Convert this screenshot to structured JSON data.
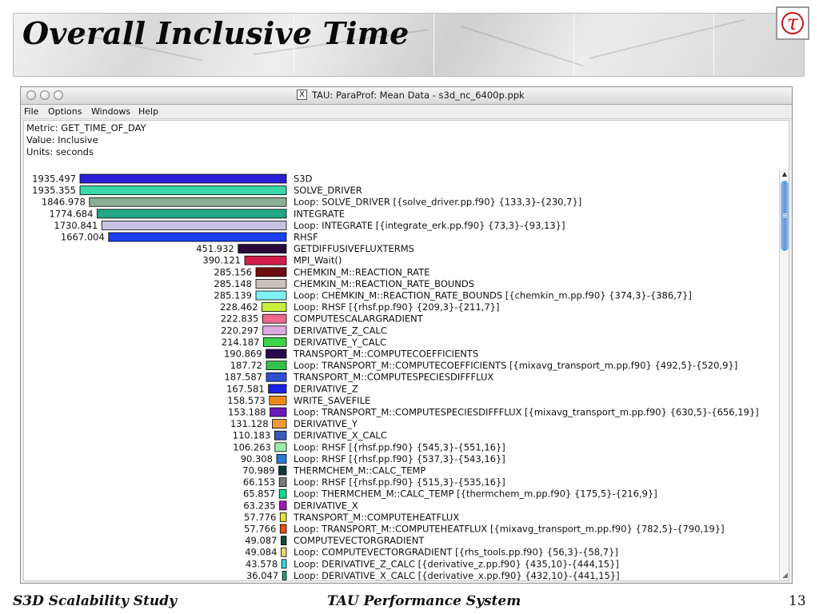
{
  "slide": {
    "title": "Overall Inclusive Time",
    "logo_glyph": "τ",
    "footer_left": "S3D Scalability Study",
    "footer_center": "TAU Performance System",
    "page_number": "13"
  },
  "window": {
    "title": "TAU: ParaProf: Mean Data - s3d_nc_6400p.ppk",
    "title_icon": "X"
  },
  "menu": [
    "File",
    "Options",
    "Windows",
    "Help"
  ],
  "info": {
    "metric": "Metric: GET_TIME_OF_DAY",
    "value": "Value: Inclusive",
    "units": "Units: seconds"
  },
  "colors": {
    "scroll_thumb": "#5f95d7",
    "title_accent": "#c41818"
  },
  "chart_data": {
    "type": "bar",
    "orientation": "horizontal",
    "max_value": 1935.497,
    "rows": [
      {
        "value": 1935.497,
        "label": "1935.497",
        "name": "S3D",
        "color": "#2b1fd6"
      },
      {
        "value": 1935.355,
        "label": "1935.355",
        "name": "SOLVE_DRIVER",
        "color": "#3ad7a8"
      },
      {
        "value": 1846.978,
        "label": "1846.978",
        "name": "Loop: SOLVE_DRIVER [{solve_driver.pp.f90} {133,3}-{230,7}]",
        "color": "#8cae95"
      },
      {
        "value": 1774.684,
        "label": "1774.684",
        "name": "INTEGRATE",
        "color": "#23a784"
      },
      {
        "value": 1730.841,
        "label": "1730.841",
        "name": "Loop: INTEGRATE [{integrate_erk.pp.f90} {73,3}-{93,13}]",
        "color": "#c6c2e2"
      },
      {
        "value": 1667.004,
        "label": "1667.004",
        "name": "RHSF",
        "color": "#1b3ff0"
      },
      {
        "value": 451.932,
        "label": "451.932",
        "name": "GETDIFFUSIVEFLUXTERMS",
        "color": "#2a0a3a"
      },
      {
        "value": 390.121,
        "label": "390.121",
        "name": "MPI_Wait()",
        "color": "#d01e4a"
      },
      {
        "value": 285.156,
        "label": "285.156",
        "name": "CHEMKIN_M::REACTION_RATE",
        "color": "#6e0e0e"
      },
      {
        "value": 285.148,
        "label": "285.148",
        "name": "CHEMKIN_M::REACTION_RATE_BOUNDS",
        "color": "#c8c3b8"
      },
      {
        "value": 285.139,
        "label": "285.139",
        "name": "Loop: CHEMKIN_M::REACTION_RATE_BOUNDS [{chemkin_m.pp.f90} {374,3}-{386,7}]",
        "color": "#7ff0f4"
      },
      {
        "value": 228.462,
        "label": "228.462",
        "name": "Loop: RHSF [{rhsf.pp.f90} {209,3}-{211,7}]",
        "color": "#c8f040"
      },
      {
        "value": 222.835,
        "label": "222.835",
        "name": "COMPUTESCALARGRADIENT",
        "color": "#ee6a8c"
      },
      {
        "value": 220.297,
        "label": "220.297",
        "name": "DERIVATIVE_Z_CALC",
        "color": "#dcaae0"
      },
      {
        "value": 214.187,
        "label": "214.187",
        "name": "DERIVATIVE_Y_CALC",
        "color": "#3bd44a"
      },
      {
        "value": 190.869,
        "label": "190.869",
        "name": "TRANSPORT_M::COMPUTECOEFFICIENTS",
        "color": "#2a0a4a"
      },
      {
        "value": 187.72,
        "label": "187.72",
        "name": "Loop: TRANSPORT_M::COMPUTECOEFFICIENTS [{mixavg_transport_m.pp.f90} {492,5}-{520,9}]",
        "color": "#36c24a"
      },
      {
        "value": 187.587,
        "label": "187.587",
        "name": "TRANSPORT_M::COMPUTESPECIESDIFFFLUX",
        "color": "#2c4fd4"
      },
      {
        "value": 167.581,
        "label": "167.581",
        "name": "DERIVATIVE_Z",
        "color": "#1a22e0"
      },
      {
        "value": 158.573,
        "label": "158.573",
        "name": "WRITE_SAVEFILE",
        "color": "#f08a1a"
      },
      {
        "value": 153.188,
        "label": "153.188",
        "name": "Loop: TRANSPORT_M::COMPUTESPECIESDIFFFLUX [{mixavg_transport_m.pp.f90} {630,5}-{656,19}]",
        "color": "#6a18b8"
      },
      {
        "value": 131.128,
        "label": "131.128",
        "name": "DERIVATIVE_Y",
        "color": "#f09a3a"
      },
      {
        "value": 110.183,
        "label": "110.183",
        "name": "DERIVATIVE_X_CALC",
        "color": "#3a5ab8"
      },
      {
        "value": 106.263,
        "label": "106.263",
        "name": "Loop: RHSF [{rhsf.pp.f90} {545,3}-{551,16}]",
        "color": "#9af0a8"
      },
      {
        "value": 90.308,
        "label": "90.308",
        "name": "Loop: RHSF [{rhsf.pp.f90} {537,3}-{543,16}]",
        "color": "#2a7ad8"
      },
      {
        "value": 70.989,
        "label": "70.989",
        "name": "THERMCHEM_M::CALC_TEMP",
        "color": "#0e3a3a"
      },
      {
        "value": 66.153,
        "label": "66.153",
        "name": "Loop: RHSF [{rhsf.pp.f90} {515,3}-{535,16}]",
        "color": "#7a7a7a"
      },
      {
        "value": 65.857,
        "label": "65.857",
        "name": "Loop: THERMCHEM_M::CALC_TEMP [{thermchem_m.pp.f90} {175,5}-{216,9}]",
        "color": "#1ad88a"
      },
      {
        "value": 63.235,
        "label": "63.235",
        "name": "DERIVATIVE_X",
        "color": "#a01ab8"
      },
      {
        "value": 57.776,
        "label": "57.776",
        "name": "TRANSPORT_M::COMPUTEHEATFLUX",
        "color": "#e8e03a"
      },
      {
        "value": 57.766,
        "label": "57.766",
        "name": "Loop: TRANSPORT_M::COMPUTEHEATFLUX [{mixavg_transport_m.pp.f90} {782,5}-{790,19}]",
        "color": "#e8501a"
      },
      {
        "value": 49.087,
        "label": "49.087",
        "name": "COMPUTEVECTORGRADIENT",
        "color": "#0e4a3a"
      },
      {
        "value": 49.084,
        "label": "49.084",
        "name": "Loop: COMPUTEVECTORGRADIENT [{rhs_tools.pp.f90} {56,3}-{58,7}]",
        "color": "#f0d07a"
      },
      {
        "value": 43.578,
        "label": "43.578",
        "name": "Loop: DERIVATIVE_Z_CALC [{derivative_z.pp.f90} {435,10}-{444,15}]",
        "color": "#3ad8d8"
      },
      {
        "value": 36.047,
        "label": "36.047",
        "name": "Loop: DERIVATIVE_X_CALC [{derivative_x.pp.f90} {432,10}-{441,15}]",
        "color": "#1aa87a"
      }
    ]
  }
}
